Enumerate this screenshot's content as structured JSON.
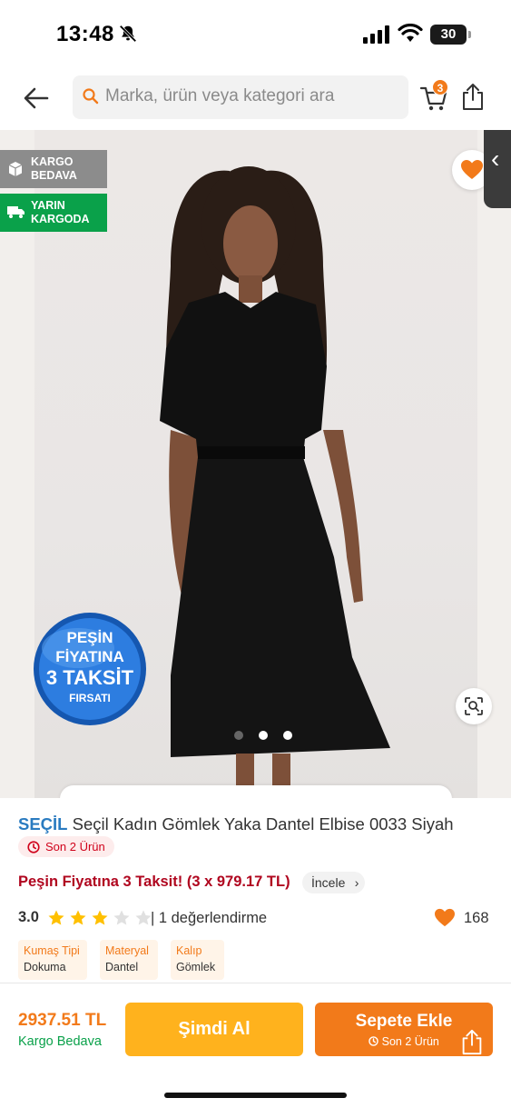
{
  "status_bar": {
    "time": "13:48",
    "battery": "30"
  },
  "search": {
    "placeholder": "Marka, ürün veya kategori ara"
  },
  "cart": {
    "badge_count": "3"
  },
  "badges": {
    "kargo": "KARGO BEDAVA",
    "yarin": "YARIN KARGODA"
  },
  "promo": {
    "line1": "PEŞİN",
    "line2": "FİYATINA",
    "line3": "3 TAKSİT",
    "line4": "FIRSATI"
  },
  "gallery": {
    "active_index": 1,
    "dot_count": 3
  },
  "product": {
    "brand": "SEÇİL",
    "name": "Seçil Kadın Gömlek Yaka Dantel Elbise 0033 Siyah",
    "stock": "Son 2 Ürün",
    "installment": "Peşin Fiyatına 3 Taksit! (3 x 979.17 TL)",
    "incele": "İncele",
    "rating": "3.0",
    "rating_value": 3,
    "rating_count": "| 1 değerlendirme",
    "favorites": "168",
    "attributes": [
      {
        "label": "Kumaş Tipi",
        "value": "Dokuma"
      },
      {
        "label": "Materyal",
        "value": "Dantel"
      },
      {
        "label": "Kalıp",
        "value": "Gömlek"
      }
    ]
  },
  "bottom": {
    "price": "2937.51 TL",
    "cargo": "Kargo Bedava",
    "buy_now": "Şimdi Al",
    "add_to_cart": "Sepete Ekle",
    "add_to_cart_sub": "Son 2 Ürün"
  },
  "colors": {
    "accent": "#f27a1a",
    "buy_now": "#ffb21d",
    "brand": "#2a7bc0",
    "green": "#0aa14a",
    "installment": "#b0061f"
  }
}
